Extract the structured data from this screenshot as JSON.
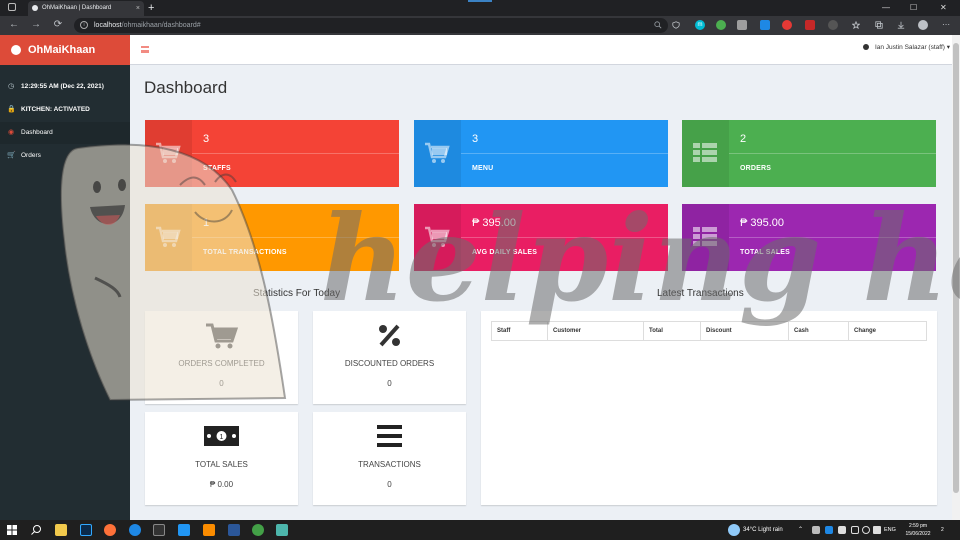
{
  "browser": {
    "tab_title": "OhMaiKhaan | Dashboard",
    "tab_close": "×",
    "new_tab": "+",
    "url_host": "localhost",
    "url_path": "/ohmaikhaan/dashboard#",
    "back": "←",
    "forward": "→",
    "reload": "⟳",
    "minimize": "—",
    "maximize": "☐",
    "close": "✕"
  },
  "app": {
    "brand": "OhMaiKhaan",
    "clock": "12:29:55 AM (Dec 22, 2021)",
    "kitchen_status": "KITCHEN: ACTIVATED",
    "nav": [
      {
        "label": "Dashboard",
        "active": true
      },
      {
        "label": "Orders",
        "active": false
      }
    ],
    "user": "Ian Justin Salazar (staff)",
    "page_title": "Dashboard"
  },
  "info_boxes": [
    {
      "value": "3",
      "label": "STAFFS",
      "color": "#f44336",
      "icon": "cart-icon"
    },
    {
      "value": "3",
      "label": "MENU",
      "color": "#2196f3",
      "icon": "cart-icon"
    },
    {
      "value": "2",
      "label": "ORDERS",
      "color": "#4caf50",
      "icon": "table-icon"
    },
    {
      "value": "1",
      "label": "TOTAL TRANSACTIONS",
      "color": "#ff9800",
      "icon": "cart-icon"
    },
    {
      "value": "₱ 395.00",
      "label": "AVG DAILY SALES",
      "color": "#e91e63",
      "icon": "cart-icon"
    },
    {
      "value": "₱ 395.00",
      "label": "TOTAL SALES",
      "color": "#9c27b0",
      "icon": "table-icon"
    }
  ],
  "stats": {
    "title": "Statistics For Today",
    "items": [
      {
        "label": "ORDERS COMPLETED",
        "value": "0",
        "icon": "cart-icon"
      },
      {
        "label": "DISCOUNTED ORDERS",
        "value": "0",
        "icon": "percent-icon"
      },
      {
        "label": "TOTAL SALES",
        "value": "₱ 0.00",
        "icon": "money-icon"
      },
      {
        "label": "TRANSACTIONS",
        "value": "0",
        "icon": "list-icon"
      }
    ]
  },
  "transactions": {
    "title": "Latest Transactions",
    "columns": [
      "Staff",
      "Customer",
      "Total",
      "Discount",
      "Cash",
      "Change"
    ]
  },
  "watermark": {
    "text": "helping hand"
  },
  "taskbar": {
    "weather": "34°C  Light rain",
    "lang": "ENG",
    "time": "2:59 pm",
    "date": "15/06/2022",
    "notifications": "2"
  }
}
